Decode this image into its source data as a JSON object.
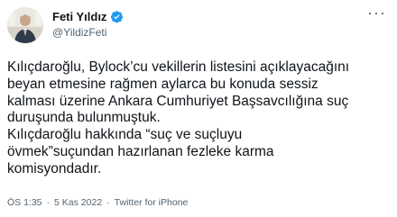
{
  "author": {
    "display_name": "Feti Yıldız",
    "handle": "@YildizFeti",
    "verified": true,
    "avatar_icon": "profile-photo",
    "verified_color": "#1d9bf0"
  },
  "menu": {
    "more_label": "···"
  },
  "tweet": {
    "lines": [
      "Kılıçdaroğlu, Bylock’cu vekillerin listesini açıklayacağını",
      "beyan etmesine rağmen aylarca bu konuda sessiz",
      "kalması üzerine Ankara Cumhuriyet Başsavcılığına suç",
      "duruşunda bulunmuştuk.",
      "Kılıçdaroğlu hakkında “suç ve suçluyu",
      "övmek”suçundan hazırlanan fezleke karma",
      "komisyondadır."
    ]
  },
  "meta": {
    "time": "ÖS 1:35",
    "date": "5 Kas 2022",
    "source": "Twitter for iPhone",
    "separator": "·"
  }
}
